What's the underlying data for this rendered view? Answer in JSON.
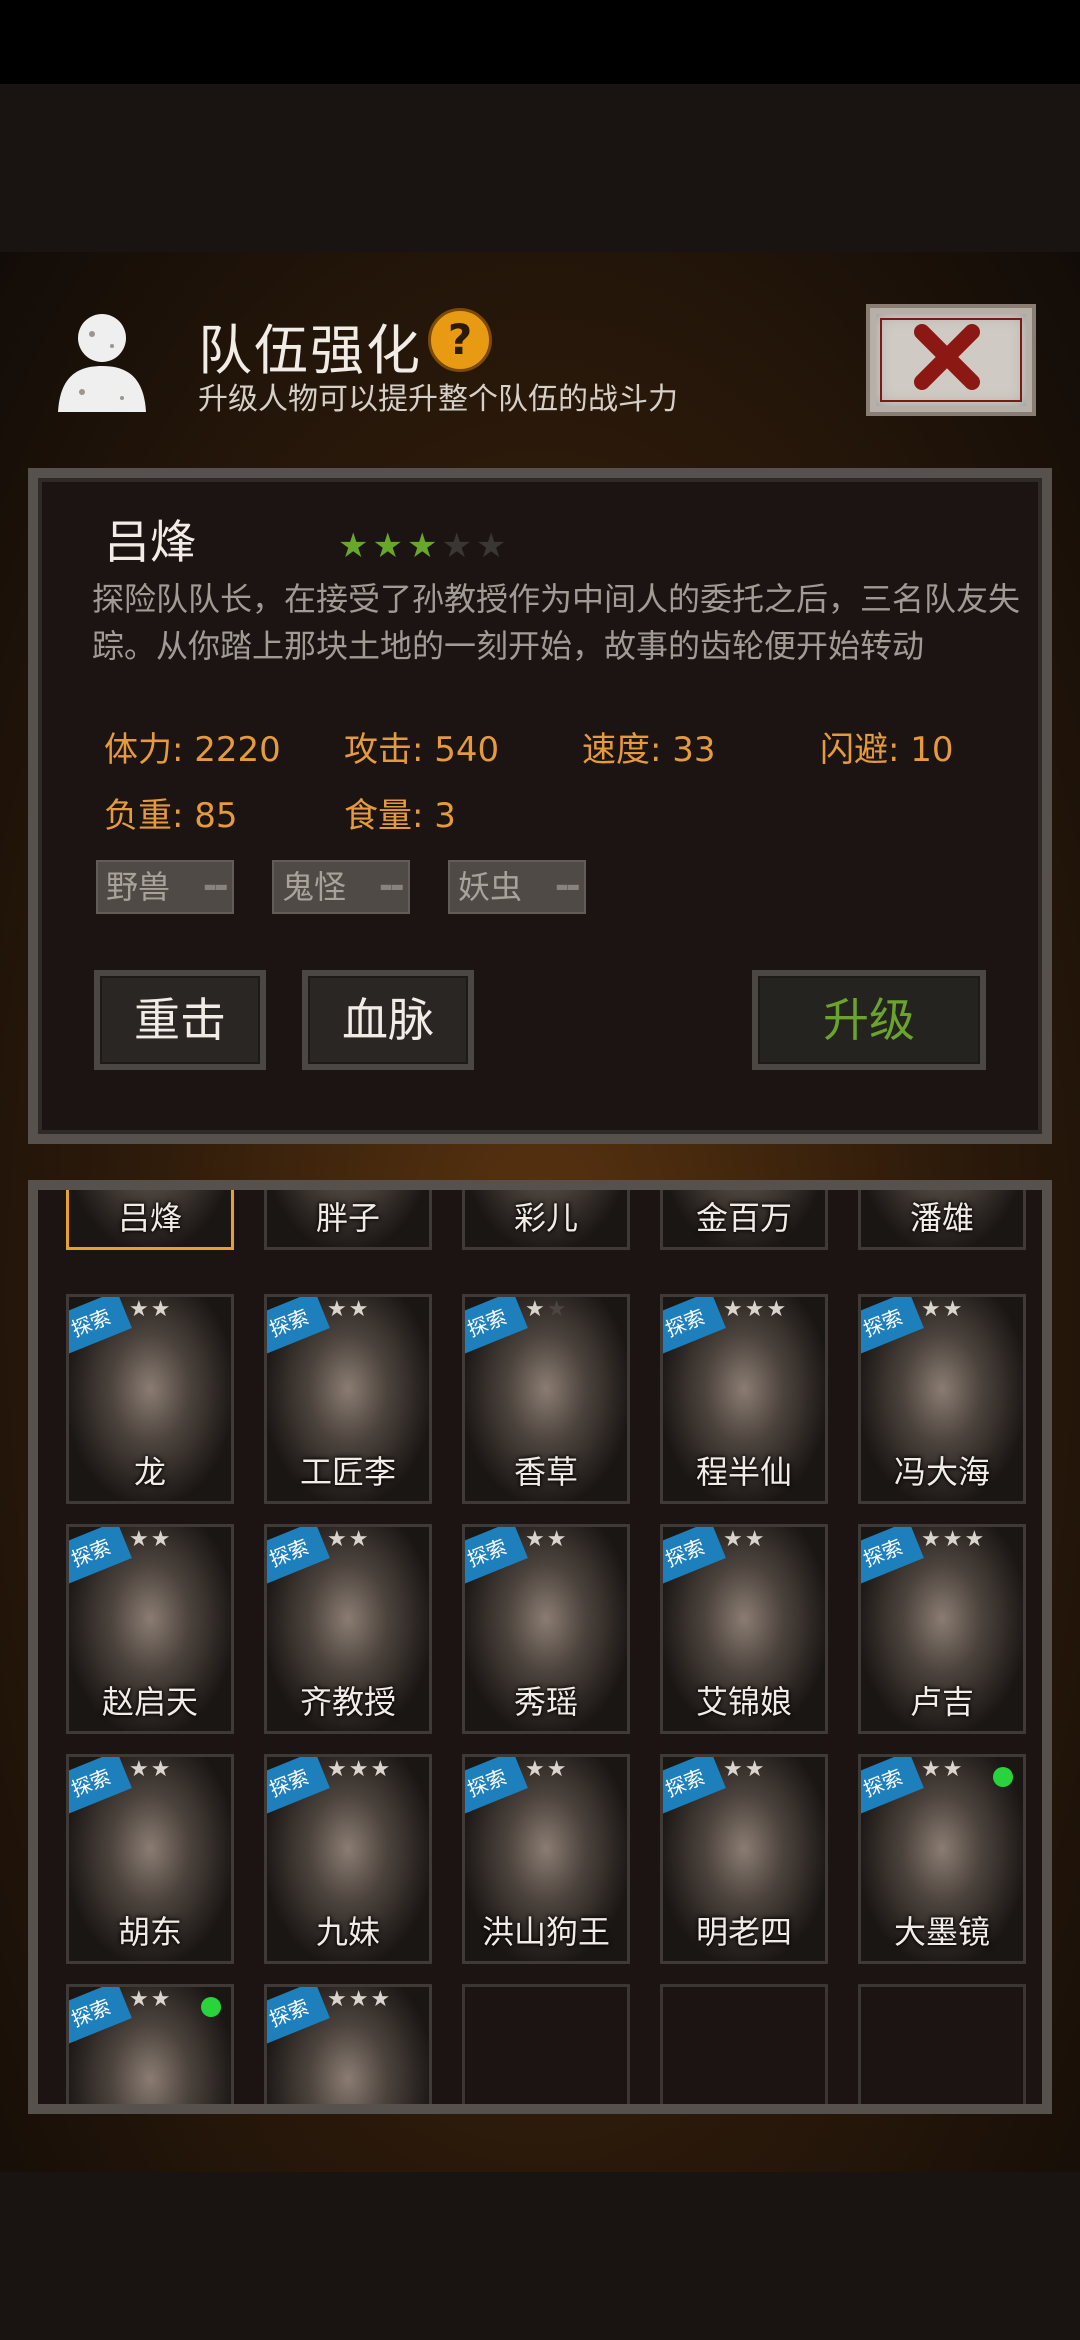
{
  "header": {
    "title": "队伍强化",
    "help_label": "?",
    "subtitle": "升级人物可以提升整个队伍的战斗力"
  },
  "detail": {
    "name": "吕烽",
    "stars_on": "★★★",
    "stars_off": "★★",
    "description": "探险队队长，在接受了孙教授作为中间人的委托之后，三名队友失踪。从你踏上那块土地的一刻开始，故事的齿轮便开始转动",
    "stats": [
      {
        "label": "体力: 2220"
      },
      {
        "label": "攻击: 540"
      },
      {
        "label": "速度: 33"
      },
      {
        "label": "闪避: 10"
      },
      {
        "label": "负重: 85"
      },
      {
        "label": "食量: 3"
      }
    ],
    "tags": [
      "野兽",
      "鬼怪",
      "妖虫"
    ],
    "buttons": {
      "heavy_strike": "重击",
      "bloodline": "血脉",
      "upgrade": "升级"
    }
  },
  "roster": {
    "badge_text": "探索",
    "top_row": [
      "吕烽",
      "胖子",
      "彩儿",
      "金百万",
      "潘雄"
    ],
    "cards": [
      {
        "name": "龙",
        "stars": "★★",
        "dim": ""
      },
      {
        "name": "工匠李",
        "stars": "★★",
        "dim": ""
      },
      {
        "name": "香草",
        "stars": "★",
        "dim": "★"
      },
      {
        "name": "程半仙",
        "stars": "★★★",
        "dim": ""
      },
      {
        "name": "冯大海",
        "stars": "★★",
        "dim": ""
      },
      {
        "name": "赵启天",
        "stars": "★★",
        "dim": ""
      },
      {
        "name": "齐教授",
        "stars": "★★",
        "dim": ""
      },
      {
        "name": "秀瑶",
        "stars": "★★",
        "dim": ""
      },
      {
        "name": "艾锦娘",
        "stars": "★★",
        "dim": ""
      },
      {
        "name": "卢吉",
        "stars": "★★★",
        "dim": ""
      },
      {
        "name": "胡东",
        "stars": "★★",
        "dim": ""
      },
      {
        "name": "九妹",
        "stars": "★★★",
        "dim": ""
      },
      {
        "name": "洪山狗王",
        "stars": "★★",
        "dim": ""
      },
      {
        "name": "明老四",
        "stars": "★★",
        "dim": ""
      },
      {
        "name": "大墨镜",
        "stars": "★★",
        "dim": ""
      },
      {
        "name": "",
        "stars": "★★",
        "dim": ""
      },
      {
        "name": "",
        "stars": "★★★",
        "dim": ""
      }
    ]
  },
  "colors": {
    "accent_green": "#6aa42a",
    "stat_orange": "#e59a3c",
    "badge_blue": "#1e7fbd",
    "online_dot": "#28d33c"
  },
  "icons": {
    "avatar": "person-silhouette-icon",
    "help": "question-icon",
    "close": "close-x-icon"
  }
}
